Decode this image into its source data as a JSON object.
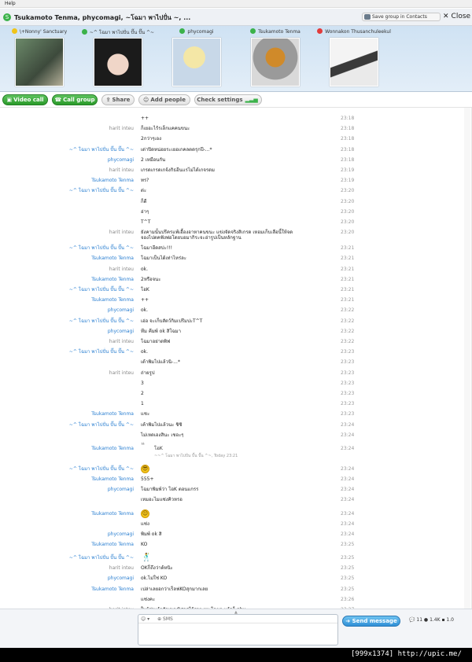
{
  "menubar": {
    "help": "Help"
  },
  "titlebar": {
    "title": "Tsukamoto Tenma, phycomagi, ~โฉมา พาไปปั่น ~, ...",
    "save_group": "Save group in Contacts",
    "close": "Close"
  },
  "participants": [
    {
      "name": "\\+Nonny' Sanctuary",
      "status_color": "#f0c419"
    },
    {
      "name": "~^ โฉมา พาไปปั่น ปั๊น ปั๊น ^~",
      "status_color": "#3bb24a"
    },
    {
      "name": "phycomagi",
      "status_color": "#3bb24a"
    },
    {
      "name": "Tsukamoto Tenma",
      "status_color": "#3bb24a"
    },
    {
      "name": "Wonnakon Thusanchuleekul",
      "status_color": "#e23b3b"
    }
  ],
  "toolbar": {
    "video_call": "Video call",
    "call_group": "Call group",
    "share": "Share",
    "add_people": "Add people",
    "check_settings": "Check settings"
  },
  "messages": [
    {
      "sender": "",
      "text": "++",
      "time": "23:18"
    },
    {
      "sender": "harit inteu",
      "text": "ก็เยอะไร้รเล็กแคคนขนะ",
      "time": "23:18"
    },
    {
      "sender": "",
      "text": "2กว่าๆเอง",
      "time": "23:18"
    },
    {
      "sender": "~^ โฉมา พาไปปั่น ปั๊น ปั๊น ^~",
      "text": "เด่าปิดหน่อยระเยอเกคลตดรุกปี-...*",
      "time": "23:18"
    },
    {
      "sender": "phycomagi",
      "text": "2 เหมือนกัน",
      "time": "23:18"
    },
    {
      "sender": "harit inteu",
      "text": "เกรดเกรดเกจ้งกิธอีนแรไม่ได้เกจรดม",
      "time": "23:19"
    },
    {
      "sender": "Tsukamoto Tenma",
      "text": "ทร?",
      "time": "23:19"
    },
    {
      "sender": "~^ โฉมา พาไปปั่น ปั๊น ปั๊น ^~",
      "text": "ด่ะ",
      "time": "23:20"
    },
    {
      "sender": "",
      "text": "ก็ดี",
      "time": "23:20"
    },
    {
      "sender": "",
      "text": "อ่าๆ",
      "time": "23:20"
    },
    {
      "sender": "",
      "text": "T^T",
      "time": "23:20"
    },
    {
      "sender": "harit inteu",
      "text": "ยังคามนั้นปรีครแพ้เอื้องอาหาคนขนะ แข่งจัดจริงสิเกรด เหอมเก็บเลือนี้ให้จดจองไปตคฟังพ่อโดยบอมากิระจะอ่ารูปเป็นหลักฐาน",
      "time": "23:20"
    },
    {
      "sender": "~^ โฉมา พาไปปั่น ปั๊น ปั๊น ^~",
      "text": "โฉมาอีดสปะ!!!",
      "time": "23:21"
    },
    {
      "sender": "Tsukamoto Tenma",
      "text": "โฉมาเป็นได้เท่าไหร่ละ",
      "time": "23:21"
    },
    {
      "sender": "harit inteu",
      "text": "ok.",
      "time": "23:21"
    },
    {
      "sender": "Tsukamoto Tenma",
      "text": "2หรือจนะ",
      "time": "23:21"
    },
    {
      "sender": "~^ โฉมา พาไปปั่น ปั๊น ปั๊น ^~",
      "text": "โอK",
      "time": "23:21"
    },
    {
      "sender": "Tsukamoto Tenma",
      "text": "++",
      "time": "23:21"
    },
    {
      "sender": "phycomagi",
      "text": "ok.",
      "time": "23:22"
    },
    {
      "sender": "~^ โฉมา พาไปปั่น ปั๊น ปั๊น ^~",
      "text": "เอ่อ จะเก็บสัตว์กิมเปรีมปะT^T",
      "time": "23:22"
    },
    {
      "sender": "phycomagi",
      "text": "ทีม คีมพ์ ok สิโฉมา",
      "time": "23:22"
    },
    {
      "sender": "harit inteu",
      "text": "โฉมาอย่าดพิฟ",
      "time": "23:22"
    },
    {
      "sender": "~^ โฉมา พาไปปั่น ปั๊น ปั๊น ^~",
      "text": "ok.",
      "time": "23:23"
    },
    {
      "sender": "",
      "text": "เด้าพิมไปแล้วนิ-...*",
      "time": "23:23"
    },
    {
      "sender": "harit inteu",
      "text": "ถ่ายรูป",
      "time": "23:23"
    },
    {
      "sender": "",
      "text": "3",
      "time": "23:23"
    },
    {
      "sender": "",
      "text": "2",
      "time": "23:23"
    },
    {
      "sender": "",
      "text": "1",
      "time": "23:23"
    },
    {
      "sender": "Tsukamoto Tenma",
      "text": "แชะ",
      "time": "23:23"
    },
    {
      "sender": "~^ โฉมา พาไปปั่น ปั๊น ปั๊น ^~",
      "text": "เค้าพิมไปแล้วนะ ชิชิ",
      "time": "23:24"
    },
    {
      "sender": "",
      "text": "ไม่เหดเองสินะ เชอะๆ",
      "time": "23:24"
    }
  ],
  "quote": {
    "sender": "Tsukamoto Tenma",
    "text": "โอK",
    "meta": "~~^ โฉมา พาไปปั่น ปั๊น ปั๊น ^~, Today 23:21",
    "time": "23:24"
  },
  "messages2": [
    {
      "sender": "~^ โฉมา พาไปปั่น ปั๊น ปั๊น ^~",
      "text": "",
      "time": "23:24",
      "emoticon": "cool"
    },
    {
      "sender": "Tsukamoto Tenma",
      "text": "555+",
      "time": "23:24"
    },
    {
      "sender": "phycomagi",
      "text": "โฉมาพิมพ์ว่า โอK ตอนแกรร",
      "time": "23:24"
    },
    {
      "sender": "",
      "text": "เหมอะไมแซ่งคิวหรอ",
      "time": "23:24"
    },
    {
      "sender": "Tsukamoto Tenma",
      "text": "",
      "time": "23:24",
      "emoticon": "smile"
    },
    {
      "sender": "",
      "text": "แซ่ง",
      "time": "23:24"
    },
    {
      "sender": "phycomagi",
      "text": "พิมพ์ ok สิ",
      "time": "23:24"
    },
    {
      "sender": "Tsukamoto Tenma",
      "text": "KO",
      "time": "23:25"
    },
    {
      "sender": "~^ โฉมา พาไปปั่น ปั๊น ปั๊น ^~",
      "text": "",
      "time": "23:25",
      "emoticon": "dance"
    },
    {
      "sender": "harit inteu",
      "text": "OKก็ถึงว่าด้หนิะ",
      "time": "23:25"
    },
    {
      "sender": "phycomagi",
      "text": "ok.ไม่ใช่ KO",
      "time": "23:25"
    },
    {
      "sender": "Tsukamoto Tenma",
      "text": "เปล่าเลยอกว่าเร็ลฟKOสุกมากเลย",
      "time": "23:25"
    },
    {
      "sender": "",
      "text": "แซ่งคะ",
      "time": "23:26"
    },
    {
      "sender": "harit inteu",
      "text": "ในผู้ช่มเก้าสัญญาณิศาสไว้ราย ผม โฉมา แล้วก็ phy",
      "time": "23:27"
    }
  ],
  "compose": {
    "emoticon_label": "☺ ▾",
    "sms_label": "SMS",
    "placeholder": "",
    "send": "Send message",
    "tray": "💬 11 ● 1.4K ▪ 1.0"
  },
  "footer": {
    "text": "[999x1374] http://upic.me/"
  }
}
